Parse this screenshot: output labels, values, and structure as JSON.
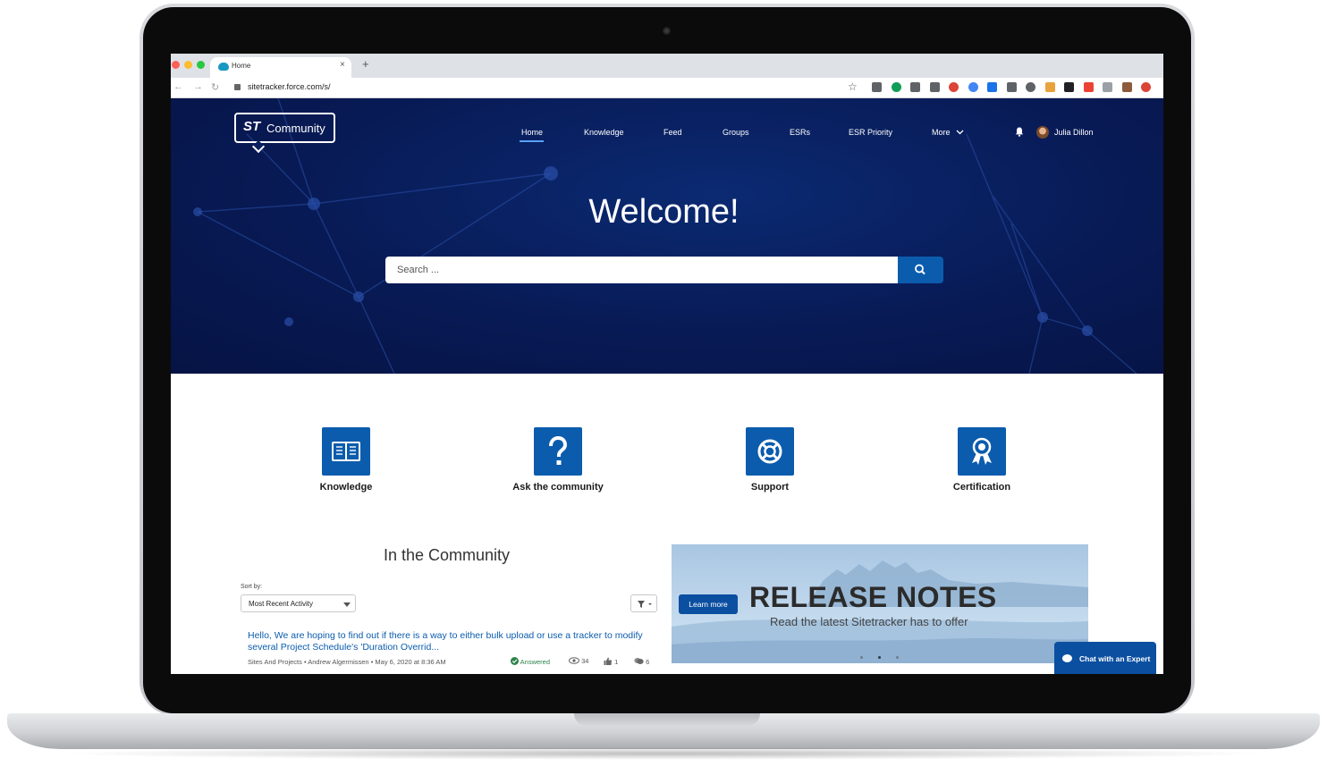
{
  "browser": {
    "tab_title": "Home",
    "tab_close": "×",
    "new_tab": "+",
    "back": "←",
    "forward": "→",
    "reload": "↻",
    "url": "sitetracker.force.com/s/",
    "bookmark": "☆",
    "extension_colors": [
      "#5f6368",
      "#0f9d58",
      "#5f6368",
      "#5f6368",
      "#db4437",
      "#4285f4",
      "#1a73e8",
      "#5f6368",
      "#5f6368",
      "#e8a33d",
      "#202124",
      "#ea4335",
      "#9aa0a6",
      "#8d5a3b",
      "#db4437"
    ]
  },
  "site": {
    "logo_mark": "ST",
    "logo_text": "Community",
    "nav": [
      "Home",
      "Knowledge",
      "Feed",
      "Groups",
      "ESRs",
      "ESR Priority",
      "More"
    ],
    "user_name": "Julia Dillon",
    "welcome": "Welcome!",
    "search_placeholder": "Search ...",
    "accent": "#0b5cad",
    "hero_color": "#081a55"
  },
  "tiles": [
    {
      "label": "Knowledge"
    },
    {
      "label": "Ask the community"
    },
    {
      "label": "Support"
    },
    {
      "label": "Certification"
    }
  ],
  "community": {
    "title": "In the Community",
    "sort_label": "Sort by:",
    "sort_value": "Most Recent Activity",
    "post": {
      "title": "Hello, We are hoping to find out if there is a way to either bulk upload or use a tracker to modify several Project Schedule's 'Duration Overrid...",
      "meta": "Sites And Projects • Andrew Algermissen • May 6, 2020 at 8:36 AM",
      "status": "Answered",
      "views": "34",
      "likes": "1",
      "comments": "6"
    }
  },
  "banner": {
    "button": "Learn more",
    "title": "RELEASE NOTES",
    "subtitle": "Read the latest Sitetracker has to offer",
    "active_slide": 2,
    "slide_count": 3
  },
  "chat": {
    "label": "Chat with an Expert"
  }
}
